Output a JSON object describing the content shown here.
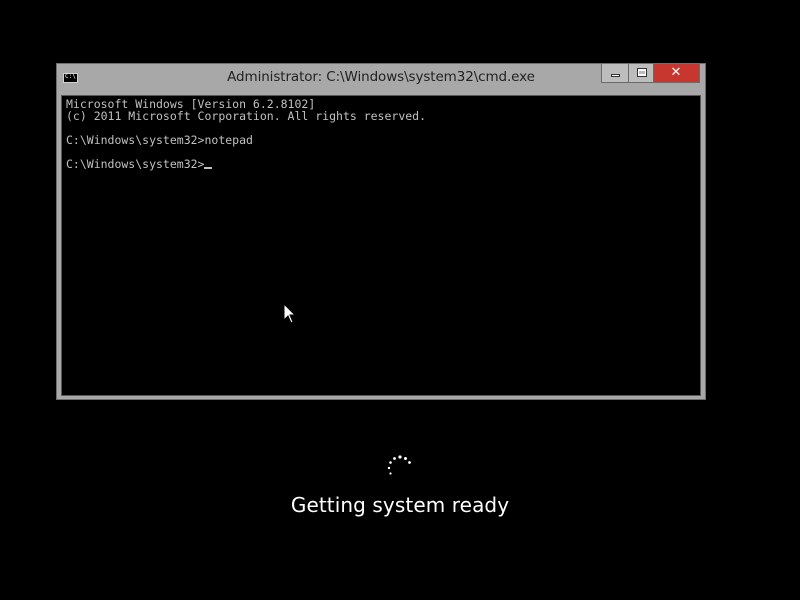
{
  "window": {
    "title": "Administrator: C:\\Windows\\system32\\cmd.exe",
    "icon": "cmd-app-icon",
    "icon_label": "C:\\",
    "buttons": {
      "minimize": "minimize-icon",
      "maximize": "maximize-icon",
      "close": "close-icon",
      "close_label": "✕"
    }
  },
  "console": {
    "lines": [
      "Microsoft Windows [Version 6.2.8102]",
      "(c) 2011 Microsoft Corporation. All rights reserved.",
      "",
      "C:\\Windows\\system32>notepad",
      "",
      "C:\\Windows\\system32>"
    ],
    "text_color": "#c0c0c0",
    "background_color": "#000000"
  },
  "status": {
    "message": "Getting system ready",
    "spinner_icon": "loading-spinner-icon"
  },
  "colors": {
    "desktop_background": "#000000",
    "title_bar": "#a8a8a8",
    "close_button": "#c7372f"
  }
}
